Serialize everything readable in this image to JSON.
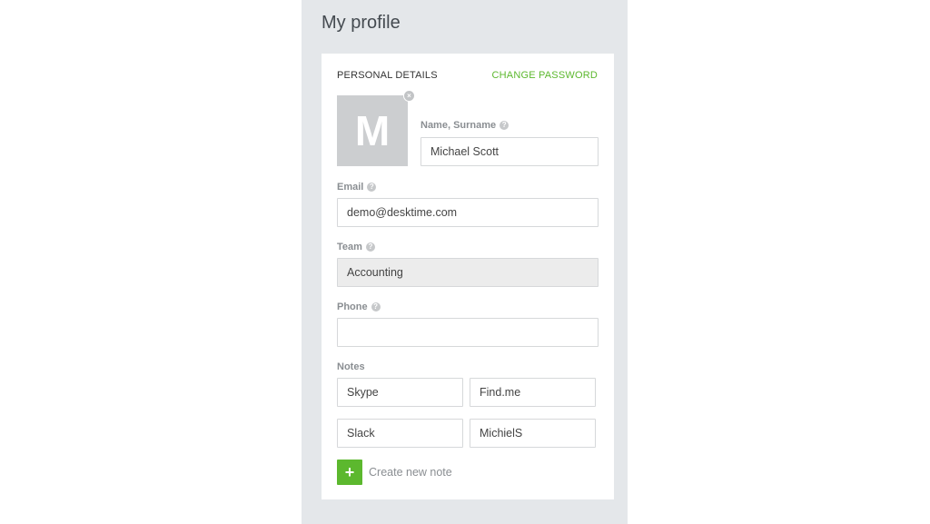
{
  "page": {
    "title": "My profile"
  },
  "personal_details": {
    "section_title": "PERSONAL DETAILS",
    "change_password_label": "CHANGE PASSWORD",
    "avatar_initial": "M",
    "avatar_close_glyph": "×",
    "help_glyph": "?",
    "fields": {
      "name": {
        "label": "Name, Surname",
        "value": "Michael Scott"
      },
      "email": {
        "label": "Email",
        "value": "demo@desktime.com"
      },
      "team": {
        "label": "Team",
        "value": "Accounting",
        "disabled": true
      },
      "phone": {
        "label": "Phone",
        "value": ""
      }
    },
    "notes": {
      "label": "Notes",
      "items": [
        {
          "key": "Skype",
          "value": "Find.me"
        },
        {
          "key": "Slack",
          "value": "MichielS"
        }
      ],
      "add_label": "Create new note",
      "add_glyph": "+"
    }
  },
  "colors": {
    "accent": "#5cb82e",
    "panel_bg": "#e4e7ea",
    "avatar_bg": "#ccced0"
  }
}
